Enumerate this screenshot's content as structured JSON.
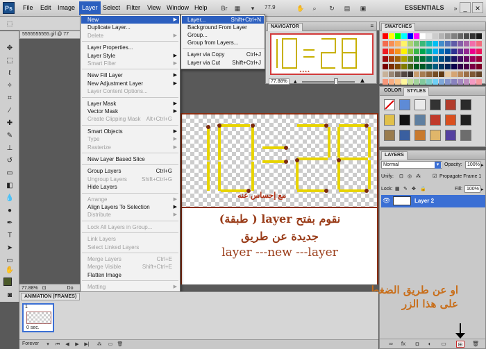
{
  "menubar": {
    "logo": "Ps",
    "items": [
      "File",
      "Edit",
      "Image",
      "Layer",
      "Select",
      "Filter",
      "View",
      "Window",
      "Help"
    ],
    "zoom": "77.9",
    "workspace": "ESSENTIALS"
  },
  "document": {
    "tab": "5555555555.gif @ 77",
    "zoom": "77.88%",
    "doc_label": "Do",
    "signature": "مع إحساس عنه"
  },
  "caption": {
    "line1": "نقوم بفتح layer ( طبقة)",
    "line2": "جديدة عن طريق",
    "line3": "layer ---new ---layer"
  },
  "annotation_right": {
    "line1": "او عن طريق الضغط",
    "line2": "على هذا الزر"
  },
  "layer_menu": {
    "items": [
      {
        "label": "New",
        "shortcut": "",
        "submenu": true,
        "disabled": false,
        "highlighted": true
      },
      {
        "label": "Duplicate Layer...",
        "shortcut": "",
        "submenu": false,
        "disabled": false
      },
      {
        "label": "Delete",
        "shortcut": "",
        "submenu": true,
        "disabled": true
      },
      {
        "label": "Layer Properties...",
        "shortcut": "",
        "submenu": false,
        "disabled": false
      },
      {
        "label": "Layer Style",
        "shortcut": "",
        "submenu": true,
        "disabled": false
      },
      {
        "label": "Smart Filter",
        "shortcut": "",
        "submenu": true,
        "disabled": true
      },
      {
        "label": "New Fill Layer",
        "shortcut": "",
        "submenu": true,
        "disabled": false
      },
      {
        "label": "New Adjustment Layer",
        "shortcut": "",
        "submenu": true,
        "disabled": false
      },
      {
        "label": "Layer Content Options...",
        "shortcut": "",
        "submenu": false,
        "disabled": true
      },
      {
        "label": "Layer Mask",
        "shortcut": "",
        "submenu": true,
        "disabled": false
      },
      {
        "label": "Vector Mask",
        "shortcut": "",
        "submenu": true,
        "disabled": false
      },
      {
        "label": "Create Clipping Mask",
        "shortcut": "Alt+Ctrl+G",
        "submenu": false,
        "disabled": true
      },
      {
        "label": "Smart Objects",
        "shortcut": "",
        "submenu": true,
        "disabled": false
      },
      {
        "label": "Type",
        "shortcut": "",
        "submenu": true,
        "disabled": true
      },
      {
        "label": "Rasterize",
        "shortcut": "",
        "submenu": true,
        "disabled": true
      },
      {
        "label": "New Layer Based Slice",
        "shortcut": "",
        "submenu": false,
        "disabled": false
      },
      {
        "label": "Group Layers",
        "shortcut": "Ctrl+G",
        "submenu": false,
        "disabled": false
      },
      {
        "label": "Ungroup Layers",
        "shortcut": "Shift+Ctrl+G",
        "submenu": false,
        "disabled": true
      },
      {
        "label": "Hide Layers",
        "shortcut": "",
        "submenu": false,
        "disabled": false
      },
      {
        "label": "Arrange",
        "shortcut": "",
        "submenu": true,
        "disabled": true
      },
      {
        "label": "Align Layers To Selection",
        "shortcut": "",
        "submenu": true,
        "disabled": false
      },
      {
        "label": "Distribute",
        "shortcut": "",
        "submenu": true,
        "disabled": true
      },
      {
        "label": "Lock All Layers in Group...",
        "shortcut": "",
        "submenu": false,
        "disabled": true
      },
      {
        "label": "Link Layers",
        "shortcut": "",
        "submenu": false,
        "disabled": true
      },
      {
        "label": "Select Linked Layers",
        "shortcut": "",
        "submenu": false,
        "disabled": true
      },
      {
        "label": "Merge Layers",
        "shortcut": "Ctrl+E",
        "submenu": false,
        "disabled": true
      },
      {
        "label": "Merge Visible",
        "shortcut": "Shift+Ctrl+E",
        "submenu": false,
        "disabled": true
      },
      {
        "label": "Flatten Image",
        "shortcut": "",
        "submenu": false,
        "disabled": false
      },
      {
        "label": "Matting",
        "shortcut": "",
        "submenu": true,
        "disabled": true
      }
    ]
  },
  "new_submenu": {
    "items": [
      {
        "label": "Layer...",
        "shortcut": "Shift+Ctrl+N",
        "highlighted": true
      },
      {
        "label": "Background From Layer",
        "shortcut": ""
      },
      {
        "label": "Group...",
        "shortcut": ""
      },
      {
        "label": "Group from Layers...",
        "shortcut": ""
      },
      {
        "label": "Layer via Copy",
        "shortcut": "Ctrl+J"
      },
      {
        "label": "Layer via Cut",
        "shortcut": "Shift+Ctrl+J"
      }
    ]
  },
  "navigator": {
    "title": "NAVIGATOR",
    "zoom": "77.88%"
  },
  "swatches": {
    "title": "SWATCHES",
    "colors": [
      "#ff0000",
      "#ffff00",
      "#00ff00",
      "#00ffff",
      "#0000ff",
      "#ff00ff",
      "#ffffff",
      "#e6e6e6",
      "#cccccc",
      "#b3b3b3",
      "#999999",
      "#808080",
      "#666666",
      "#4d4d4d",
      "#333333",
      "#1a1a1a",
      "#f26c4f",
      "#f68e55",
      "#fbaf5c",
      "#fff467",
      "#acd372",
      "#7cc576",
      "#3bb878",
      "#1abbb4",
      "#00bff3",
      "#438cca",
      "#5574b9",
      "#605ca8",
      "#855fa8",
      "#a763a8",
      "#f06eaa",
      "#f26d7d",
      "#ed1c24",
      "#f26522",
      "#f7941d",
      "#fff200",
      "#8dc63f",
      "#39b54a",
      "#00a651",
      "#00a99d",
      "#00aeef",
      "#0072bc",
      "#0054a6",
      "#2e3192",
      "#662d91",
      "#92278f",
      "#ec008c",
      "#ed145b",
      "#9e0b0f",
      "#a0410d",
      "#a36209",
      "#aba000",
      "#598527",
      "#1a7b30",
      "#007236",
      "#00746b",
      "#0076a3",
      "#004b80",
      "#003471",
      "#1b1464",
      "#440e62",
      "#630460",
      "#9e005d",
      "#9e0039",
      "#790000",
      "#7b2e00",
      "#7d4900",
      "#827b00",
      "#406618",
      "#005e20",
      "#005826",
      "#005952",
      "#005b7f",
      "#003663",
      "#002157",
      "#0d004c",
      "#32004b",
      "#4b0049",
      "#7b0046",
      "#7a0026",
      "#c7b299",
      "#998675",
      "#736357",
      "#534741",
      "#37302d",
      "#c69c6d",
      "#a67c52",
      "#8c6239",
      "#754c24",
      "#603913",
      "#e8c9a0",
      "#d5a574",
      "#b7885a",
      "#9a6f46",
      "#7e5835",
      "#634428",
      "#f7977a",
      "#f9ad81",
      "#fdc68a",
      "#fff79a",
      "#c4df9b",
      "#a3d39c",
      "#82ca9d",
      "#7bcdc8",
      "#6ecff6",
      "#7ea7d8",
      "#8493ca",
      "#8882be",
      "#a187be",
      "#bc8dbf",
      "#f49ac2",
      "#f6989d"
    ]
  },
  "color_styles": {
    "tab_color": "COLOR",
    "tab_styles": "STYLES"
  },
  "layers": {
    "title": "LAYERS",
    "blend_mode": "Normal",
    "opacity_label": "Opacity:",
    "opacity": "100%",
    "unify_label": "Unify:",
    "propagate_label": "Propagate Frame 1",
    "lock_label": "Lock:",
    "fill_label": "Fill:",
    "fill": "100%",
    "layer_name": "Layer 2"
  },
  "animation": {
    "title": "ANIMATION (FRAMES)",
    "frame_number": "1",
    "frame_time": "0 sec.",
    "loop": "Forever"
  }
}
